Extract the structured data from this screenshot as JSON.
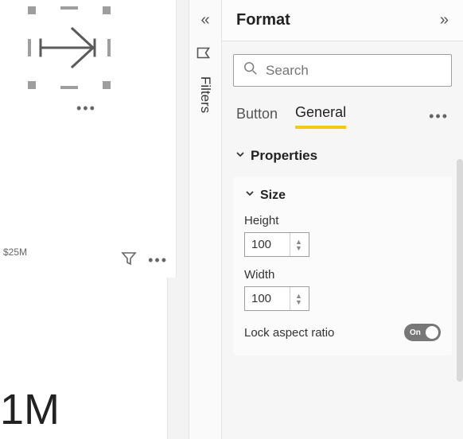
{
  "canvas": {
    "axis_label": "$25M",
    "big_number": "1M"
  },
  "filters_rail": {
    "label": "Filters"
  },
  "format": {
    "title": "Format",
    "search_placeholder": "Search",
    "tabs": {
      "button": "Button",
      "general": "General"
    },
    "properties": {
      "title": "Properties",
      "size": {
        "title": "Size",
        "height_label": "Height",
        "height_value": "100",
        "width_label": "Width",
        "width_value": "100",
        "lock_label": "Lock aspect ratio",
        "lock_state": "On"
      }
    }
  }
}
